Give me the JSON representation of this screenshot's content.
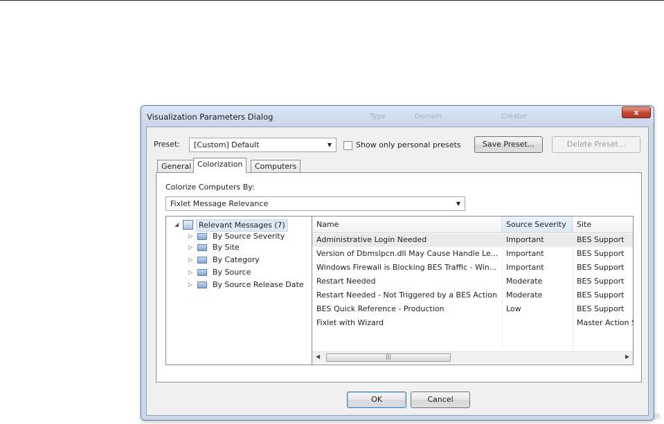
{
  "window": {
    "title": "Visualization Parameters Dialog",
    "ghost_text": [
      "Type",
      "Domain",
      "Creator"
    ],
    "close_glyph": "x"
  },
  "preset": {
    "label": "Preset:",
    "value": "[Custom] Default",
    "show_personal_label": "Show only personal presets",
    "save_button": "Save Preset...",
    "delete_button": "Delete Preset..."
  },
  "tabs": [
    {
      "label": "General"
    },
    {
      "label": "Colorization"
    },
    {
      "label": "Computers"
    }
  ],
  "colorize": {
    "label": "Colorize Computers By:",
    "value": "Fixlet Message Relevance"
  },
  "tree": {
    "root": "Relevant Messages (7)",
    "items": [
      {
        "label": "By Source Severity"
      },
      {
        "label": "By Site"
      },
      {
        "label": "By Category"
      },
      {
        "label": "By Source"
      },
      {
        "label": "By Source Release Date"
      }
    ]
  },
  "list": {
    "columns": [
      "Name",
      "Source Severity",
      "Site"
    ],
    "rows": [
      {
        "name": "Administrative Login Needed",
        "severity": "Important",
        "site": "BES Support"
      },
      {
        "name": "Version of Dbmslpcn.dll May Cause Handle Le...",
        "severity": "Important",
        "site": "BES Support"
      },
      {
        "name": "Windows Firewall is Blocking BES Traffic - Win...",
        "severity": "Important",
        "site": "BES Support"
      },
      {
        "name": "Restart Needed",
        "severity": "Moderate",
        "site": "BES Support"
      },
      {
        "name": "Restart Needed - Not Triggered by a BES Action",
        "severity": "Moderate",
        "site": "BES Support"
      },
      {
        "name": "BES Quick Reference - Production",
        "severity": "Low",
        "site": "BES Support"
      },
      {
        "name": "Fixlet with Wizard",
        "severity": "",
        "site": "Master Action Site"
      }
    ]
  },
  "footer": {
    "ok": "OK",
    "cancel": "Cancel"
  }
}
